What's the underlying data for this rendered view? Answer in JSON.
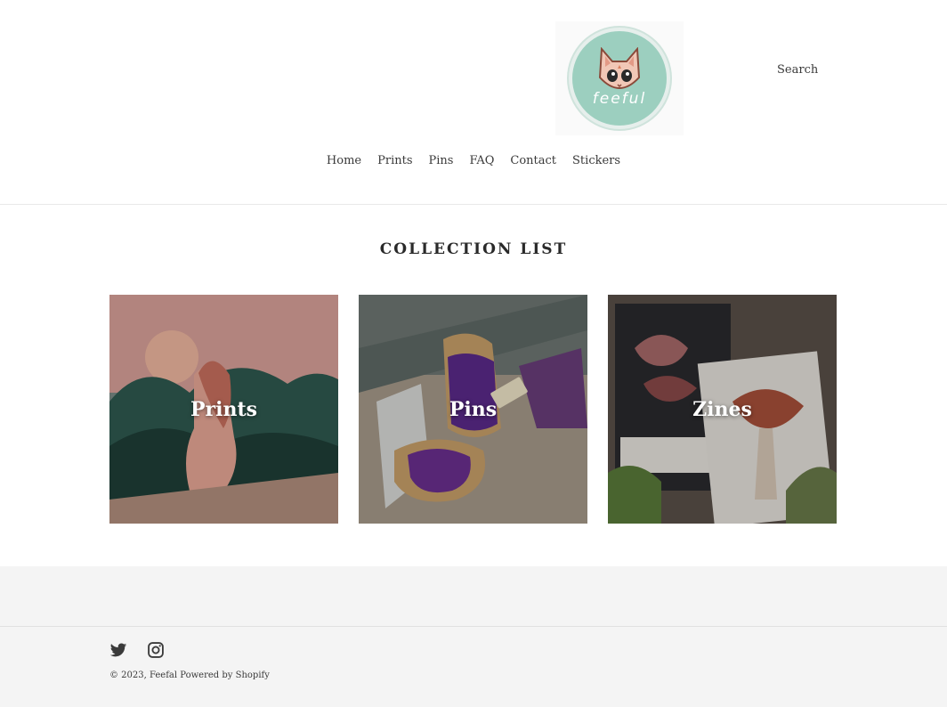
{
  "header": {
    "logo_text": "feeful",
    "search_label": "Search"
  },
  "nav": {
    "items": [
      {
        "label": "Home"
      },
      {
        "label": "Prints"
      },
      {
        "label": "Pins"
      },
      {
        "label": "FAQ"
      },
      {
        "label": "Contact"
      },
      {
        "label": "Stickers"
      }
    ]
  },
  "main": {
    "title": "COLLECTION LIST",
    "collections": [
      {
        "label": "Prints"
      },
      {
        "label": "Pins"
      },
      {
        "label": "Zines"
      }
    ]
  },
  "footer": {
    "social_icons": [
      "twitter-icon",
      "instagram-icon"
    ],
    "copyright_prefix": "© 2023, ",
    "store_link": "Feefal",
    "powered_by": " Powered by Shopify"
  },
  "colors": {
    "logo_bg": "#9ccfbf",
    "footer_bg": "#f4f4f4",
    "text": "#3a3a3a"
  }
}
